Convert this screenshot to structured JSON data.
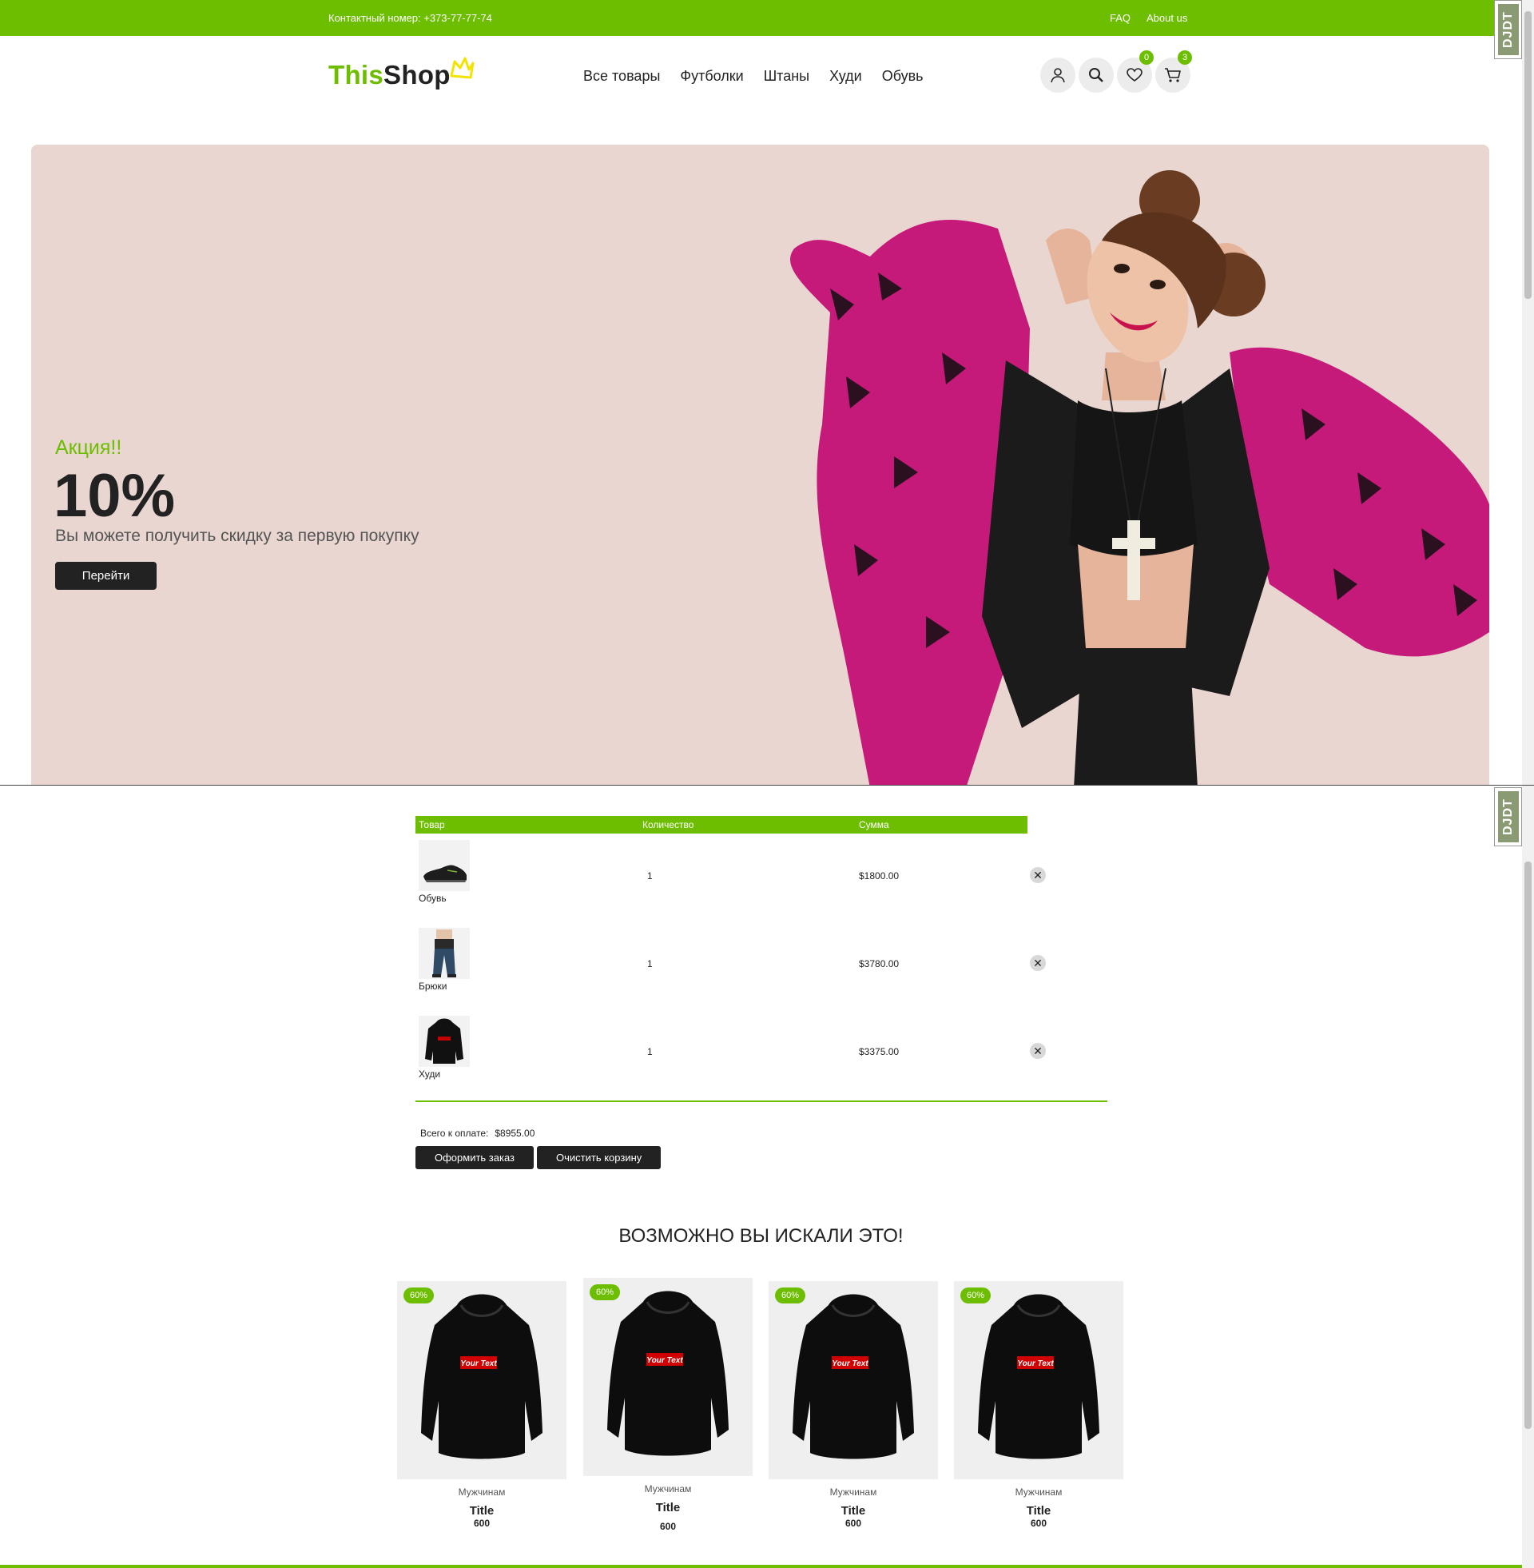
{
  "topbar": {
    "phone": "Контактный номер: +373-77-77-74",
    "faq": "FAQ",
    "about": "About us"
  },
  "logo": {
    "part1": "This",
    "part2": "Shop"
  },
  "nav": [
    "Все товары",
    "Футболки",
    "Штаны",
    "Худи",
    "Обувь"
  ],
  "header_icons": {
    "wishlist_count": "0",
    "cart_count": "3"
  },
  "hero": {
    "promo": "Акция!!",
    "discount": "10%",
    "subtitle": "Вы можете получить скидку за первую покупку",
    "button": "Перейти"
  },
  "debug_toolbar": "DJDT",
  "cart": {
    "headers": {
      "product": "Товар",
      "quantity": "Количество",
      "sum": "Сумма"
    },
    "items": [
      {
        "name": "Обувь",
        "qty": "1",
        "sum": "$1800.00",
        "icon": "sneaker-icon"
      },
      {
        "name": "Брюки",
        "qty": "1",
        "sum": "$3780.00",
        "icon": "jeans-icon"
      },
      {
        "name": "Худи",
        "qty": "1",
        "sum": "$3375.00",
        "icon": "hoodie-icon"
      }
    ],
    "total_label": "Всего к оплате:",
    "total_value": "$8955.00",
    "checkout": "Оформить заказ",
    "clear": "Очистить корзину",
    "remove_glyph": "✕"
  },
  "recommendations": {
    "title": "ВОЗМОЖНО ВЫ ИСКАЛИ ЭТО!",
    "print_text": "Your Text",
    "items": [
      {
        "discount": "60%",
        "category": "Мужчинам",
        "title": "Title",
        "price": "600"
      },
      {
        "discount": "60%",
        "category": "Мужчинам",
        "title": "Title",
        "price": "600"
      },
      {
        "discount": "60%",
        "category": "Мужчинам",
        "title": "Title",
        "price": "600"
      },
      {
        "discount": "60%",
        "category": "Мужчинам",
        "title": "Title",
        "price": "600"
      }
    ]
  },
  "colors": {
    "accent": "#6dbe00",
    "dark": "#222222",
    "hero_bg": "#e9d6d0"
  }
}
